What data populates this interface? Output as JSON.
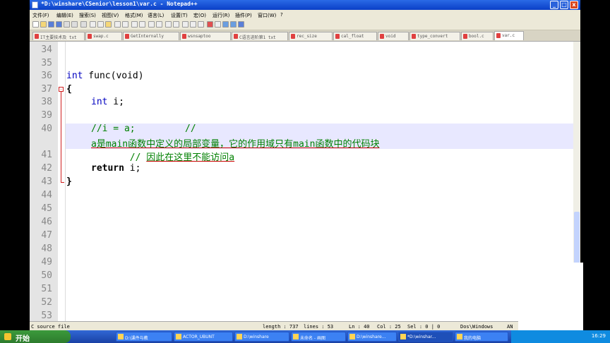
{
  "window": {
    "title": "*D:\\winshare\\CSenior\\lesson1\\var.c - Notepad++",
    "buttons": {
      "minimize": "_",
      "maximize": "□",
      "close": "x"
    }
  },
  "menu": [
    "文件(F)",
    "编辑(E)",
    "搜索(S)",
    "视图(V)",
    "格式(M)",
    "语言(L)",
    "设置(T)",
    "宏(O)",
    "运行(R)",
    "插件(P)",
    "窗口(W)",
    "?"
  ],
  "tabs": [
    "IT主要技术及 txt",
    "swap.c",
    "GetInternally",
    "wsnsaptoo",
    "C语言进阶第1 txt",
    "rec_size",
    "cal_float",
    "void",
    "type_convert",
    "bool.c",
    "var.c"
  ],
  "editor": {
    "line_numbers": [
      "34",
      "35",
      "36",
      "37",
      "38",
      "39",
      "40",
      "",
      "41",
      "42",
      "43",
      "44",
      "45",
      "46",
      "47",
      "48",
      "49",
      "50",
      "51",
      "52",
      "53"
    ],
    "code": {
      "l36_kw": "int",
      "l36_rest": " func(void)",
      "l37": "{",
      "l38_kw": "int",
      "l38_rest": " i;",
      "l40a": "//i = a;         //",
      "l40b": "a是main函数中定义的局部变量，它的作用域只有main函数中的代码块",
      "l41a": "       // ",
      "l41b": "因此在这里不能访问a",
      "l42_kw": "return",
      "l42_rest": " i;",
      "l43": "}"
    },
    "fold_marker": "-"
  },
  "status": {
    "filetype": "C source file",
    "length": "length : 737",
    "lines": "lines : 53",
    "ln": "Ln : 40",
    "col": "Col : 25",
    "sel": "Sel : 0 | 0",
    "eol": "Dos\\Windows",
    "enc": "AN"
  },
  "taskbar": {
    "start": "开始",
    "items": [
      "D:\\课件与教",
      "ACTOR_UBUNT",
      "D:\\winshare",
      "未命名 - 画图",
      "D:\\winshare...",
      "*D:\\winshar...",
      "我的电脑"
    ],
    "time": "16:29"
  }
}
